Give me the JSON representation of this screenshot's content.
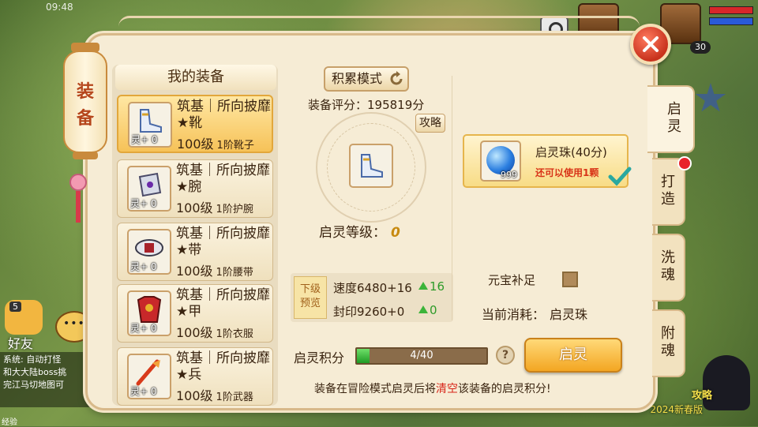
{
  "status_bar": {
    "time": "09:48"
  },
  "hud": {
    "level": "30",
    "friend_label": "好友",
    "mascot_count": "5",
    "chat_lines": [
      "系统: 自动打怪",
      "和大大陆boss挑",
      "完江马切地图可"
    ],
    "promo_title": "攻略",
    "promo_sub": "2024新春版",
    "exp_label": "经验"
  },
  "panel": {
    "lantern_title": [
      "装",
      "备"
    ],
    "list_header": "我的装备",
    "items": [
      {
        "name": "筑基｜所向披靡★靴",
        "level": "100级",
        "type": "1阶靴子",
        "enhance": "灵+ 0",
        "icon": "boot-icon"
      },
      {
        "name": "筑基｜所向披靡★腕",
        "level": "100级",
        "type": "1阶护腕",
        "enhance": "灵+ 0",
        "icon": "bracer-icon"
      },
      {
        "name": "筑基｜所向披靡★带",
        "level": "100级",
        "type": "1阶腰带",
        "enhance": "灵+ 0",
        "icon": "belt-icon"
      },
      {
        "name": "筑基｜所向披靡★甲",
        "level": "100级",
        "type": "1阶衣服",
        "enhance": "灵+ 0",
        "icon": "armor-icon"
      },
      {
        "name": "筑基｜所向披靡★兵",
        "level": "100级",
        "type": "1阶武器",
        "enhance": "灵+ 0",
        "icon": "weapon-icon"
      }
    ],
    "accum_mode": "积累模式",
    "score": "装备评分：195819分",
    "guide": "攻略",
    "spirit_level_label": "启灵等级：",
    "spirit_level_value": "0",
    "preview_tag": [
      "下级",
      "预览"
    ],
    "stats": [
      {
        "label": "速度6480+16",
        "gain": "16"
      },
      {
        "label": "封印9260+0",
        "gain": "0"
      }
    ],
    "bead": {
      "name": "启灵珠(40分)",
      "hint": "还可以使用1颗",
      "qty": "999"
    },
    "ingot_label": "元宝补足",
    "cost_label": "当前消耗：",
    "cost_value": "启灵珠",
    "points_label": "启灵积分",
    "points_text": "4/40",
    "points_fraction": 0.1,
    "awaken_button": "启灵",
    "help": "?",
    "warning_pre": "装备在冒险模式启灵后将",
    "warning_red": "清空",
    "warning_post": "该装备的启灵积分!"
  },
  "tabs": [
    {
      "label": "启\n灵",
      "active": true
    },
    {
      "label": "打\n造",
      "active": false
    },
    {
      "label": "洗\n魂",
      "active": false
    },
    {
      "label": "附\n魂",
      "active": false
    }
  ],
  "colors": {
    "accent": "#f3a622",
    "warning": "#d8261a",
    "gain": "#2e9b2a",
    "panel_bg": "#f6ecd5"
  }
}
